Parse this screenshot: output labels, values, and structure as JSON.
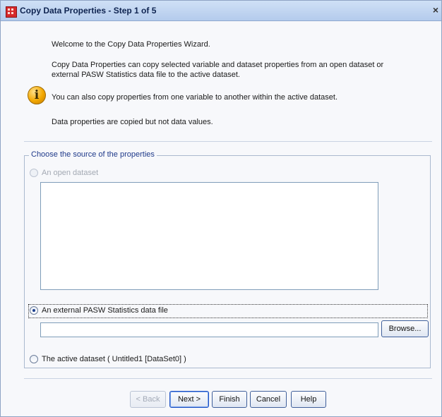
{
  "window": {
    "title": "Copy Data Properties - Step 1 of 5",
    "close_glyph": "×"
  },
  "intro": {
    "welcome": "Welcome to the Copy Data Properties Wizard.",
    "description_line1": "Copy Data Properties can copy selected variable and dataset properties from an open dataset or",
    "description_line2": "external PASW Statistics data file to the active dataset.",
    "tip": "You can also copy properties from one variable to another within the active dataset.",
    "note": "Data properties are copied but not data values.",
    "info_icon": "info-icon",
    "info_glyph": "i"
  },
  "source": {
    "legend": "Choose the source of the properties",
    "options": {
      "open_dataset": {
        "label": "An open dataset",
        "selected": false,
        "enabled": false
      },
      "external_file": {
        "label": "An external PASW Statistics data file",
        "selected": true,
        "enabled": true
      },
      "active_dataset": {
        "label": "The active dataset ( Untitled1 [DataSet0] )",
        "selected": false,
        "enabled": true
      }
    },
    "open_datasets_list": [],
    "file_path": "",
    "browse_label": "Browse..."
  },
  "buttons": {
    "back": "< Back",
    "next": "Next >",
    "finish": "Finish",
    "cancel": "Cancel",
    "help": "Help"
  },
  "colors": {
    "titlebar": "#b4cbec",
    "legend_text": "#1f3a8a",
    "info_icon": "#f3a800",
    "app_icon": "#d6292b"
  }
}
